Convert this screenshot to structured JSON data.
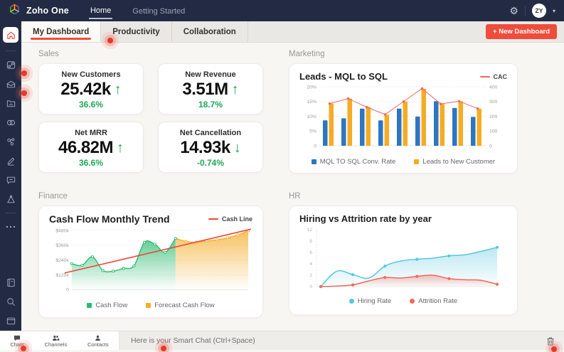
{
  "topbar": {
    "brand": "Zoho One",
    "nav": [
      {
        "label": "Home"
      },
      {
        "label": "Getting Started"
      }
    ],
    "avatar_initials": "ZY"
  },
  "tabs": {
    "items": [
      {
        "label": "My Dashboard"
      },
      {
        "label": "Productivity"
      },
      {
        "label": "Collaboration"
      }
    ],
    "new_dashboard_label": "+ New Dashboard"
  },
  "sections": {
    "sales": {
      "label": "Sales",
      "cards": [
        {
          "title": "New Customers",
          "value": "25.42k",
          "arrow": "↑",
          "percent": "36.6%"
        },
        {
          "title": "New Revenue",
          "value": "3.51M",
          "arrow": "↑",
          "percent": "18.7%"
        },
        {
          "title": "Net MRR",
          "value": "46.82M",
          "arrow": "↑",
          "percent": "36.6%"
        },
        {
          "title": "Net Cancellation",
          "value": "14.93k",
          "arrow": "↓",
          "percent": "-0.74%"
        }
      ]
    },
    "marketing": {
      "label": "Marketing"
    },
    "finance": {
      "label": "Finance"
    },
    "hr": {
      "label": "HR"
    }
  },
  "chart_data": [
    {
      "id": "leads-mql-to-sql",
      "type": "bar",
      "title": "Leads - MQL to SQL",
      "left_axis": {
        "max": 20,
        "ticks": [
          {
            "label": "20%",
            "value": 20
          },
          {
            "label": "15%",
            "value": 15
          },
          {
            "label": "10%",
            "value": 10
          },
          {
            "label": "5%",
            "value": 5
          },
          {
            "label": "0",
            "value": 0
          }
        ]
      },
      "right_axis": {
        "max": 400,
        "ticks": [
          {
            "label": "400",
            "value": 400
          },
          {
            "label": "300",
            "value": 300
          },
          {
            "label": "200",
            "value": 200
          },
          {
            "label": "100",
            "value": 100
          },
          {
            "label": "0",
            "value": 0
          }
        ]
      },
      "series": [
        {
          "name": "MQL TO SQL Conv. Rate",
          "color": "#2e75c3",
          "values": [
            8.6,
            9.3,
            12.6,
            8.6,
            12.6,
            9.9,
            15.1,
            12.8,
            9.8
          ]
        },
        {
          "name": "Leads to New Customer",
          "color": "#f5ac25",
          "values": [
            14.3,
            16.0,
            13.2,
            10.5,
            15.0,
            19.3,
            14.2,
            15.1,
            12.6
          ]
        }
      ],
      "line_series": {
        "name": "CAC",
        "color": "#f2665c",
        "axis": "right",
        "values": [
          286,
          320,
          262,
          212,
          300,
          388,
          284,
          302,
          252
        ]
      }
    },
    {
      "id": "cash-flow-monthly-trend",
      "type": "area",
      "title": "Cash Flow Monthly Trend",
      "y_axis": {
        "max": 480,
        "ticks": [
          {
            "label": "$480k",
            "value": 480
          },
          {
            "label": "$360k",
            "value": 360
          },
          {
            "label": "$240k",
            "value": 240
          },
          {
            "label": "$120k",
            "value": 120
          },
          {
            "label": "0",
            "value": 0
          }
        ]
      },
      "series": [
        {
          "name": "Cash Flow",
          "color": "#2abb6f",
          "values": [
            210,
            197,
            266,
            155,
            150,
            172,
            192,
            383,
            368,
            302,
            415
          ]
        },
        {
          "name": "Forecast Cash Flow",
          "color": "#f3ae2c",
          "values": [
            415,
            390,
            383,
            394,
            403,
            420,
            442,
            478
          ]
        }
      ],
      "line_series": {
        "name": "Cash Line",
        "color": "#f0453a",
        "start_value": 135,
        "end_value": 490
      }
    },
    {
      "id": "hiring-vs-attrition",
      "type": "line",
      "title": "Hiring vs Attrition rate by year",
      "y_axis": {
        "stops": [
          0,
          2,
          4,
          6,
          8,
          12
        ],
        "ticks": [
          {
            "label": "12",
            "value": 12
          },
          {
            "label": "8",
            "value": 8
          },
          {
            "label": "6",
            "value": 6
          },
          {
            "label": "4",
            "value": 4
          },
          {
            "label": "2",
            "value": 2
          },
          {
            "label": "0",
            "value": 0
          }
        ]
      },
      "series": [
        {
          "name": "Hiring Rate",
          "color": "#56c7de",
          "values": [
            0,
            2.7,
            2.1,
            1.5,
            3.6,
            4.5,
            4.8,
            5.0,
            5.4,
            5.6,
            6.2,
            6.9
          ],
          "dot_indices": [
            0,
            2,
            4,
            6,
            8,
            11
          ]
        },
        {
          "name": "Attrition Rate",
          "color": "#f2685e",
          "values": [
            0,
            0.1,
            0.3,
            1.0,
            1.6,
            1.5,
            1.8,
            2.0,
            1.4,
            1.2,
            1.1,
            0.4
          ],
          "dot_indices": [
            0,
            2,
            4,
            6,
            8,
            11
          ]
        }
      ]
    }
  ],
  "bottombar": {
    "tabs": [
      {
        "label": "Chats"
      },
      {
        "label": "Channels"
      },
      {
        "label": "Contacts"
      }
    ],
    "smart_chat_placeholder": "Here is your Smart Chat (Ctrl+Space)"
  },
  "colors": {
    "accent_red": "#ef4c3b",
    "kpi_green": "#1fa755",
    "dark_nav": "#232b44"
  }
}
